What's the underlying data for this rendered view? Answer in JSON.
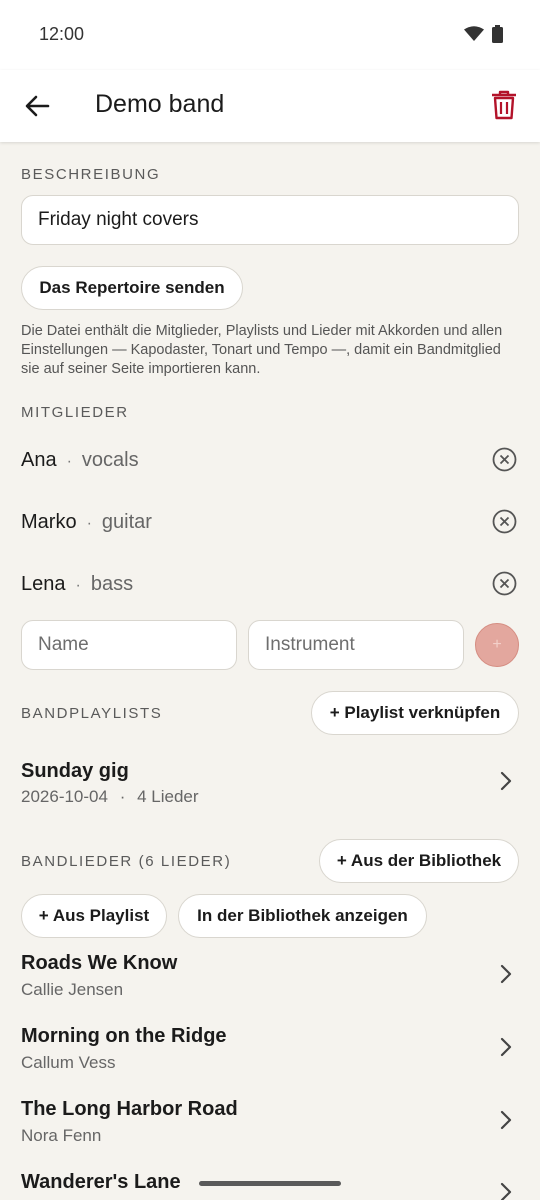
{
  "status": {
    "time": "12:00"
  },
  "appbar": {
    "title": "Demo band"
  },
  "description": {
    "label": "BESCHREIBUNG",
    "value": "Friday night covers",
    "send_button": "Das Repertoire senden",
    "help": "Die Datei enthält die Mitglieder, Playlists und Lieder mit Akkorden und allen Einstellungen — Kapodaster, Tonart und Tempo —, damit ein Bandmitglied sie auf seiner Seite importieren kann."
  },
  "members": {
    "label": "MITGLIEDER",
    "separator": "·",
    "items": [
      {
        "name": "Ana",
        "instrument": "vocals"
      },
      {
        "name": "Marko",
        "instrument": "guitar"
      },
      {
        "name": "Lena",
        "instrument": "bass"
      }
    ],
    "name_placeholder": "Name",
    "instrument_placeholder": "Instrument",
    "add_glyph": "+"
  },
  "playlists": {
    "label": "BANDPLAYLISTS",
    "link_button": "+ Playlist verknüpfen",
    "items": [
      {
        "title": "Sunday gig",
        "date": "2026-10-04",
        "separator": "·",
        "count": "4 Lieder"
      }
    ]
  },
  "songs": {
    "label": "BANDLIEDER (6 LIEDER)",
    "from_library_button": "+ Aus der Bibliothek",
    "from_playlist_button": "+ Aus Playlist",
    "show_in_library_button": "In der Bibliothek anzeigen",
    "items": [
      {
        "title": "Roads We Know",
        "artist": "Callie Jensen"
      },
      {
        "title": "Morning on the Ridge",
        "artist": "Callum Vess"
      },
      {
        "title": "The Long Harbor Road",
        "artist": "Nora Fenn"
      },
      {
        "title": "Wanderer's Lane",
        "artist": ""
      }
    ]
  },
  "icons": {
    "back": "arrow-left-icon",
    "trash": "trash-icon",
    "remove": "close-circle-icon",
    "chevron": "chevron-right-icon",
    "wifi": "wifi-icon",
    "battery": "battery-icon"
  },
  "colors": {
    "background": "#f5f3ee",
    "trash": "#b3132a",
    "add_button": "#e3a79e"
  }
}
